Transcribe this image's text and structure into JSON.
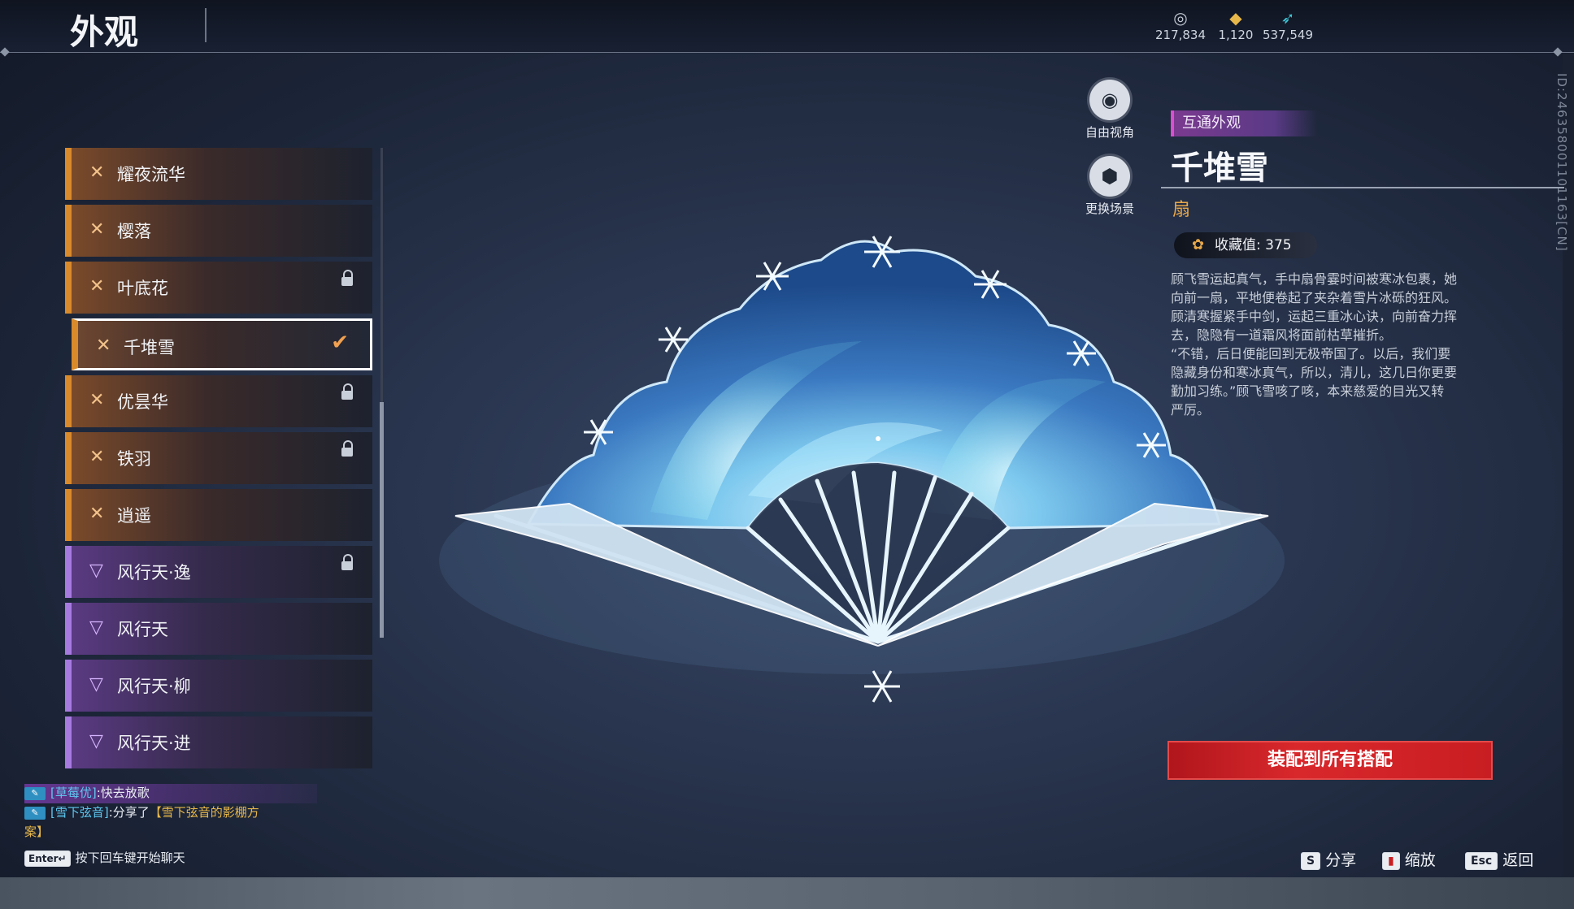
{
  "header": {
    "title": "外观",
    "currencies": [
      {
        "icon": "coin-icon",
        "value": "217,834"
      },
      {
        "icon": "ticket-icon",
        "value": "1,120"
      },
      {
        "icon": "feather-icon",
        "value": "537,549"
      }
    ]
  },
  "side_id": "ID:246358001101163[CN]",
  "list": {
    "items": [
      {
        "label": "耀夜流华",
        "kind": "orange",
        "locked": false,
        "selected": false
      },
      {
        "label": "樱落",
        "kind": "orange",
        "locked": false,
        "selected": false
      },
      {
        "label": "叶底花",
        "kind": "orange",
        "locked": true,
        "selected": false
      },
      {
        "label": "千堆雪",
        "kind": "orange",
        "locked": false,
        "selected": true
      },
      {
        "label": "优昙华",
        "kind": "orange",
        "locked": true,
        "selected": false
      },
      {
        "label": "铁羽",
        "kind": "orange",
        "locked": true,
        "selected": false
      },
      {
        "label": "逍遥",
        "kind": "orange",
        "locked": false,
        "selected": false
      },
      {
        "label": "风行天·逸",
        "kind": "purple",
        "locked": true,
        "selected": false
      },
      {
        "label": "风行天",
        "kind": "purple",
        "locked": false,
        "selected": false
      },
      {
        "label": "风行天·柳",
        "kind": "purple",
        "locked": false,
        "selected": false
      },
      {
        "label": "风行天·进",
        "kind": "purple",
        "locked": false,
        "selected": false
      }
    ]
  },
  "side_buttons": {
    "free_view": "自由视角",
    "change_scene": "更换场景"
  },
  "detail": {
    "tag": "互通外观",
    "name": "千堆雪",
    "type": "扇",
    "collect_label": "收藏值: 375",
    "description": "顾飞雪运起真气，手中扇骨霎时间被寒冰包裹，她\n向前一扇，平地便卷起了夹杂着雪片冰砾的狂风。\n顾清寒握紧手中剑，运起三重冰心诀，向前奋力挥\n去，隐隐有一道霜风将面前枯草摧折。\n“不错，后日便能回到无极帝国了。以后，我们要\n隐藏身份和寒冰真气，所以，清儿，这几日你更要\n勤加习练。”顾飞雪咳了咳，本来慈爱的目光又转\n严厉。",
    "equip_button": "装配到所有搭配"
  },
  "chat": {
    "lines": [
      {
        "user": "[草莓优]",
        "text": ":快去放歌",
        "link": ""
      },
      {
        "user": "[雪下弦音]",
        "text": ":分享了",
        "link": "【雪下弦音的影棚方"
      },
      {
        "user": "",
        "text": "",
        "link": "案】"
      }
    ],
    "enter_key": "Enter↵",
    "hint": "按下回车键开始聊天"
  },
  "hints": {
    "share_key": "S",
    "share": "分享",
    "zoom": "缩放",
    "back_key": "Esc",
    "back": "返回"
  },
  "colors": {
    "accent_orange": "#d98a2b",
    "accent_purple": "#a77ae0",
    "equip_red": "#c81d22",
    "tag_magenta": "#d84fd0"
  }
}
